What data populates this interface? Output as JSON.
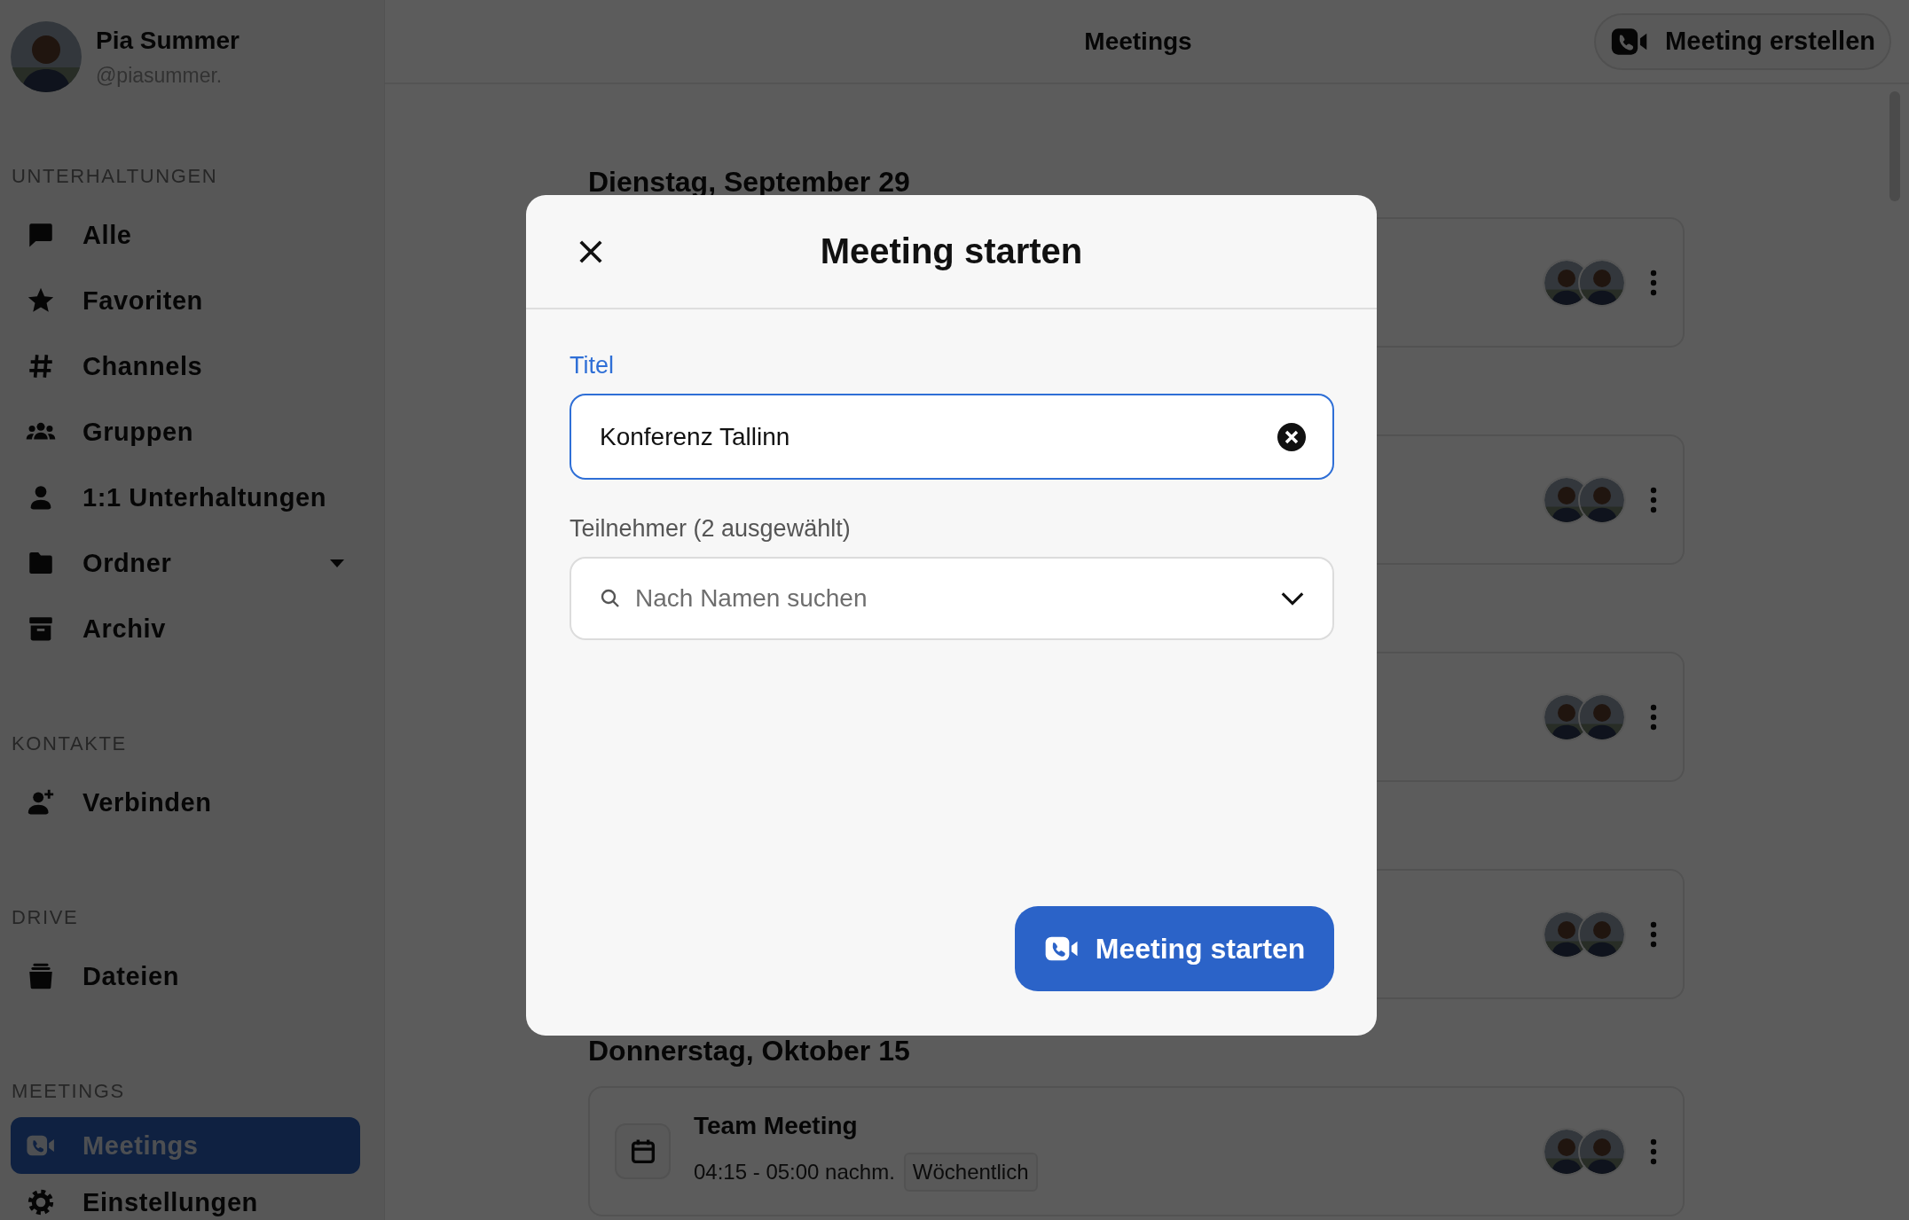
{
  "user": {
    "name": "Pia Summer",
    "handle": "@piasummer."
  },
  "sidebar": {
    "sections": [
      {
        "heading": "UNTERHALTUNGEN",
        "items": [
          {
            "label": "Alle",
            "selected": false
          },
          {
            "label": "Favoriten",
            "selected": false
          },
          {
            "label": "Channels",
            "selected": false
          },
          {
            "label": "Gruppen",
            "selected": false
          },
          {
            "label": "1:1 Unterhaltungen",
            "selected": false
          },
          {
            "label": "Ordner",
            "selected": false,
            "expanded": false
          },
          {
            "label": "Archiv",
            "selected": false
          }
        ]
      },
      {
        "heading": "KONTAKTE",
        "items": [
          {
            "label": "Verbinden",
            "selected": false
          }
        ]
      },
      {
        "heading": "DRIVE",
        "items": [
          {
            "label": "Dateien",
            "selected": false
          }
        ]
      },
      {
        "heading": "MEETINGS",
        "items": [
          {
            "label": "Meetings",
            "selected": true
          },
          {
            "label": "Einstellungen",
            "selected": false
          }
        ]
      }
    ]
  },
  "header": {
    "title": "Meetings",
    "create_button": "Meeting erstellen"
  },
  "days": [
    {
      "heading": "Dienstag, September 29"
    },
    {
      "heading": "Donnerstag, Oktober 15",
      "meetings": [
        {
          "title": "Team Meeting",
          "time": "04:15 - 05:00 nachm.",
          "recurrence": "Wöchentlich"
        }
      ]
    }
  ],
  "dialog": {
    "title": "Meeting starten",
    "fields": [
      {
        "kind": "text",
        "label": "Titel",
        "value": "Konferenz Tallinn",
        "focused": true
      },
      {
        "kind": "select",
        "label": "Teilnehmer (2 ausgewählt)",
        "placeholder": "Nach Namen suchen",
        "focused": false
      }
    ],
    "submit": "Meeting starten"
  }
}
